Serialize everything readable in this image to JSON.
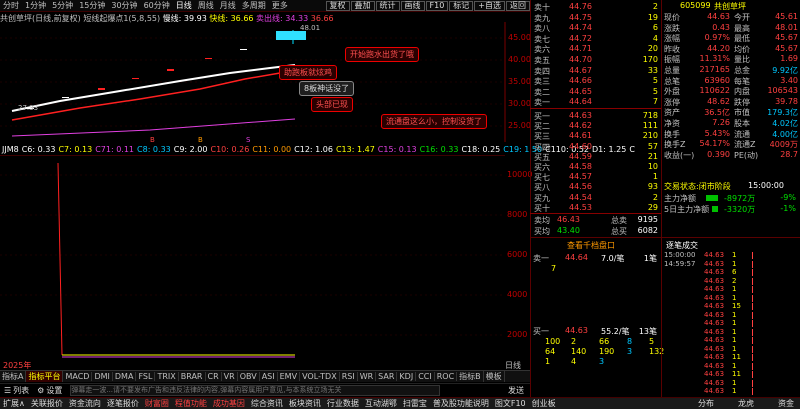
{
  "toolbar": {
    "periods": [
      "分时",
      "1分钟",
      "5分钟",
      "15分钟",
      "30分钟",
      "60分钟",
      "日线",
      "周线",
      "月线",
      "多周期",
      "更多"
    ],
    "active_period": "日线",
    "buttons": [
      "复权",
      "叠加",
      "统计",
      "画线",
      "F10",
      "标记",
      "+自选",
      "返回"
    ]
  },
  "title_line": {
    "stock": "共创草坪(日线,前复权)",
    "indicator": "短线起爆点1(5,8,55)",
    "slow_label": "慢线: 39.93",
    "fast_label": "快线: 36.66",
    "sell_label": "卖出线: 34.33",
    "last_label": "36.66"
  },
  "price_axis": [
    "45.00",
    "40.00",
    "35.00",
    "30.00",
    "25.00"
  ],
  "high_marker": "48.01",
  "low_marker": "27.33",
  "annotations": [
    {
      "text": "开始跑水出货了哦",
      "style": "red"
    },
    {
      "text": "助跑板就炫鸡",
      "style": "red"
    },
    {
      "text": "8板神话没了",
      "style": "grey"
    },
    {
      "text": "头部已现",
      "style": "red"
    },
    {
      "text": "流通盘这么小，控制没货了",
      "style": "red"
    }
  ],
  "markers": [
    "B",
    "B",
    "S"
  ],
  "indicator_bar": {
    "name": "JJM8",
    "items": [
      {
        "t": "C6: 0.33",
        "c": "w"
      },
      {
        "t": "C7: 0.13",
        "c": "y"
      },
      {
        "t": "C71: 0.11",
        "c": "mg"
      },
      {
        "t": "C8: 0.33",
        "c": "c"
      },
      {
        "t": "C9: 2.00",
        "c": "w"
      },
      {
        "t": "C10: 0.26",
        "c": "r"
      },
      {
        "t": "C11: 0.00",
        "c": "o"
      },
      {
        "t": "C12: 1.06",
        "c": "w"
      },
      {
        "t": "C13: 1.47",
        "c": "y"
      },
      {
        "t": "C15: 0.13",
        "c": "mg"
      },
      {
        "t": "C16: 0.33",
        "c": "g"
      },
      {
        "t": "C18: 0.25",
        "c": "w"
      },
      {
        "t": "C19: 1.50",
        "c": "c"
      },
      {
        "t": "C110: 0.52",
        "c": "w"
      },
      {
        "t": "D1: 1.25",
        "c": "w"
      },
      {
        "t": "C",
        "c": "w"
      }
    ]
  },
  "vol_axis": [
    "10000",
    "8000",
    "6000",
    "4000",
    "2000"
  ],
  "date_label": "2025年",
  "tabs": [
    "指标A",
    "指标平台",
    "MACD",
    "DMI",
    "DMA",
    "FSL",
    "TRIX",
    "BRAR",
    "CR",
    "VR",
    "OBV",
    "ASI",
    "EMV",
    "VOL-TDX",
    "RSI",
    "WR",
    "SAR",
    "KDJ",
    "CCI",
    "ROC",
    "指标B",
    "模板"
  ],
  "active_tab": "指标平台",
  "input_bar": {
    "list_btn": "列表",
    "settings_btn": "设置",
    "placeholder": "弹幕走一波...请不要发布广告和违反法律的内容,弹幕内容属用户意见,与本系统立场无关",
    "send_btn": "发送"
  },
  "bottom_bar": {
    "left": [
      "扩展∧",
      "关联报价",
      "资金流向",
      "逐笔报价",
      "财富圈",
      "程值功能",
      "成功基因",
      "综合资讯",
      "板块资讯",
      "行业数据",
      "互动湖鄂",
      "扫雷宝",
      "普及股功能说明",
      "图文F10",
      "创业板"
    ],
    "right": [
      "分布",
      "龙虎",
      "资金"
    ],
    "highlight": [
      "财富圈",
      "程值功能",
      "成功基因"
    ]
  },
  "order_book": {
    "sell": [
      {
        "label": "卖十",
        "price": "44.76",
        "vol": "2"
      },
      {
        "label": "卖九",
        "price": "44.75",
        "vol": "19"
      },
      {
        "label": "卖八",
        "price": "44.74",
        "vol": "6"
      },
      {
        "label": "卖七",
        "price": "44.72",
        "vol": "4"
      },
      {
        "label": "卖六",
        "price": "44.71",
        "vol": "20"
      },
      {
        "label": "卖五",
        "price": "44.70",
        "vol": "170"
      },
      {
        "label": "卖四",
        "price": "44.67",
        "vol": "33"
      },
      {
        "label": "卖三",
        "price": "44.66",
        "vol": "5"
      },
      {
        "label": "卖二",
        "price": "44.65",
        "vol": "5"
      },
      {
        "label": "卖一",
        "price": "44.64",
        "vol": "7"
      }
    ],
    "buy": [
      {
        "label": "买一",
        "price": "44.63",
        "vol": "718"
      },
      {
        "label": "买二",
        "price": "44.62",
        "vol": "111"
      },
      {
        "label": "买三",
        "price": "44.61",
        "vol": "210"
      },
      {
        "label": "买四",
        "price": "44.60",
        "vol": "57"
      },
      {
        "label": "买五",
        "price": "44.59",
        "vol": "21"
      },
      {
        "label": "买六",
        "price": "44.58",
        "vol": "10"
      },
      {
        "label": "买七",
        "price": "44.57",
        "vol": "1"
      },
      {
        "label": "买八",
        "price": "44.56",
        "vol": "93"
      },
      {
        "label": "买九",
        "price": "44.54",
        "vol": "2"
      },
      {
        "label": "买十",
        "price": "44.53",
        "vol": "29"
      }
    ],
    "avg_sell": {
      "label": "卖均",
      "price": "46.43",
      "tlabel": "总卖",
      "total": "9195"
    },
    "avg_buy": {
      "label": "买均",
      "price": "43.40",
      "tlabel": "总买",
      "total": "6082"
    },
    "depth_title": "查看千档盘口",
    "sell1_detail": {
      "label": "卖一",
      "price": "44.64",
      "sz": "7.0/笔",
      "cnt": "1笔",
      "vol": "7"
    },
    "buy1_detail": {
      "label": "买一",
      "price": "44.63",
      "sz": "55.2/笔",
      "cnt": "13笔"
    },
    "buy_grid": [
      [
        "100",
        "2",
        "66",
        "8",
        "5"
      ],
      [
        "64",
        "140",
        "190",
        "3",
        "132"
      ],
      [
        "1",
        "4",
        "3",
        "",
        ""
      ]
    ]
  },
  "info": {
    "code": "605099",
    "name": "共创草坪",
    "rows": [
      [
        "现价",
        "44.63",
        "今开",
        "45.61"
      ],
      [
        "涨跌",
        "0.43",
        "最高",
        "48.01"
      ],
      [
        "涨幅",
        "0.97%",
        "最低",
        "45.67"
      ],
      [
        "昨收",
        "44.20",
        "均价",
        "45.67"
      ],
      [
        "振幅",
        "11.31%",
        "量比",
        "1.69"
      ],
      [
        "总量",
        "217165",
        "总金",
        "9.92亿"
      ],
      [
        "总笔",
        "63960",
        "每笔",
        "3.40"
      ],
      [
        "外盘",
        "110622",
        "内盘",
        "106543"
      ],
      [
        "涨停",
        "48.62",
        "跌停",
        "39.78"
      ],
      [
        "资产",
        "36.5亿",
        "市值",
        "179.3亿"
      ],
      [
        "净资",
        "7.26",
        "股本",
        "4.02亿"
      ],
      [
        "换手",
        "5.43%",
        "流通",
        "4.00亿"
      ],
      [
        "换手Z",
        "54.17%",
        "流通Z",
        "4009万"
      ],
      [
        "收益(一)",
        "0.390",
        "PE(动)",
        "28.7"
      ]
    ],
    "status": "交易状态:闭市阶段",
    "time": "15:00:00",
    "netflow": [
      {
        "label": "主力净额",
        "val": "-8972万",
        "pct": "-9%"
      },
      {
        "label": "5日主力净额",
        "val": "-3320万",
        "pct": "-1%"
      }
    ]
  },
  "tape_title": "逐笔成交",
  "tape": [
    [
      "15:00:00",
      "44.63",
      "1"
    ],
    [
      "14:59:57",
      "44.63",
      "1"
    ],
    [
      "",
      "44.63",
      "6"
    ],
    [
      "",
      "44.63",
      "2"
    ],
    [
      "",
      "44.63",
      "1"
    ],
    [
      "",
      "44.63",
      "1"
    ],
    [
      "",
      "44.63",
      "15"
    ],
    [
      "",
      "44.63",
      "1"
    ],
    [
      "",
      "44.63",
      "1"
    ],
    [
      "",
      "44.63",
      "1"
    ],
    [
      "",
      "44.63",
      "1"
    ],
    [
      "",
      "44.63",
      "1"
    ],
    [
      "",
      "44.63",
      "11"
    ],
    [
      "",
      "44.63",
      "1"
    ],
    [
      "",
      "44.63",
      "11"
    ],
    [
      "",
      "44.63",
      "1"
    ],
    [
      "",
      "44.63",
      "1"
    ]
  ]
}
